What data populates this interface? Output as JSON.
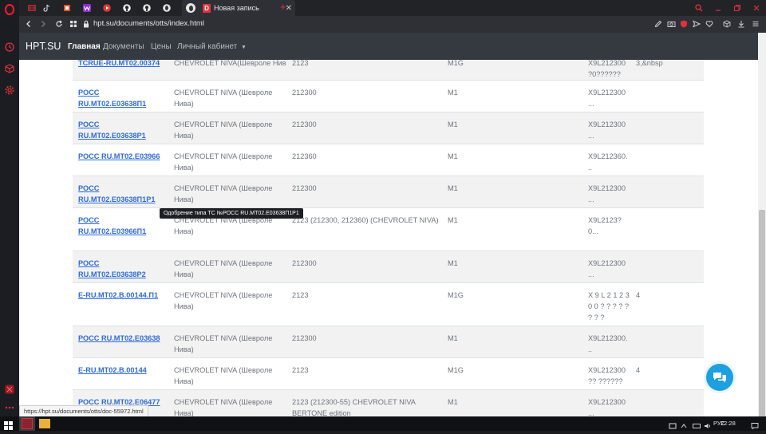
{
  "browser": {
    "tab_title": "Новая запись",
    "tab_letter": "D",
    "url": "hpt.su/documents/otts/index.html",
    "status_url": "https://hpt.su/documents/otts/doc-55972.html",
    "tab_favicons": [
      "opera-gx-icon",
      "tiktok-icon",
      "office-icon",
      "w-icon",
      "youtube-icon",
      "github-icon",
      "github-icon",
      "opera-icon"
    ]
  },
  "navbar": {
    "brand": "HPT.SU",
    "links": [
      {
        "label": "Главная",
        "active": true
      },
      {
        "label": "Документы",
        "active": false
      },
      {
        "label": "Цены",
        "active": false
      },
      {
        "label": "Личный кабинет",
        "active": false
      }
    ]
  },
  "table": {
    "rows": [
      {
        "doc": "TCRUE-RU.MT02.00374",
        "model": "CHEVROLET NIVA(Шевроле Нив",
        "variant": "2123",
        "category": "M1G",
        "vin": "X9L212300 ?0??????",
        "extra": "3,&nbsp"
      },
      {
        "doc": "РОСС RU.MT02.E03638П1",
        "model": "CHEVROLET NIVA (Шевроле Нива)",
        "variant": "212300",
        "category": "M1",
        "vin": "X9L212300 ...",
        "extra": ""
      },
      {
        "doc": "РОСС RU.MT02.E03638P1",
        "model": "CHEVROLET NIVA (Шевроле Нива)",
        "variant": "212300",
        "category": "M1",
        "vin": "X9L212300 ...",
        "extra": ""
      },
      {
        "doc": "РОСС RU.MT02.E03966",
        "model": "CHEVROLET NIVA (Шевроле Нива)",
        "variant": "212360",
        "category": "M1",
        "vin": "X9L212360. ..",
        "extra": ""
      },
      {
        "doc": "РОСС RU.MT02.E03638П1P1",
        "model": "CHEVROLET NIVA (Шевроле Нива)",
        "variant": "212300",
        "category": "M1",
        "vin": "X9L212300 ...",
        "extra": ""
      },
      {
        "doc": "РОСС RU.MT02.E03966П1",
        "model": "CHEVROLET NIVA (Шевроле Нива)",
        "variant": "2123 (212300, 212360) (CHEVROLET NIVA)",
        "category": "M1",
        "vin": "X9L2123? 0...",
        "extra": ""
      },
      {
        "doc": "РОСС RU.MT02.E03638P2",
        "model": "CHEVROLET NIVA (Шевроле Нива)",
        "variant": "212300",
        "category": "M1",
        "vin": "X9L212300 ...",
        "extra": ""
      },
      {
        "doc": "E-RU.MT02.B.00144.П1",
        "model": "CHEVROLET NIVA (Шевроле Нива)",
        "variant": "2123",
        "category": "M1G",
        "vin": "X 9 L 2 1 2 3 0 0 ? ? ? ? ? ? ? ?",
        "extra": "4"
      },
      {
        "doc": "РОСС RU.MT02.E03638",
        "model": "CHEVROLET NIVA (Шевроле Нива)",
        "variant": "212300",
        "category": "M1",
        "vin": "X9L212300. ..",
        "extra": ""
      },
      {
        "doc": "E-RU.MT02.B.00144",
        "model": "CHEVROLET NIVA (Шевроле Нива)",
        "variant": "2123",
        "category": "M1G",
        "vin": "X9L212300 ?? ??????",
        "extra": "4"
      },
      {
        "doc": "РОСС RU.MT02.E06477",
        "model": "CHEVROLET NIVA (Шевроле Нива)",
        "variant": "2123 (212300-55) CHEVROLET NIVA BERTONE edition",
        "category": "M1",
        "vin": "X9L212300 ...",
        "extra": ""
      }
    ]
  },
  "tooltip": "Одобрение типа ТС №РОСС RU.MT02.E03638П1Р1",
  "taskbar": {
    "lang": "РУС",
    "time": "22:28"
  },
  "colors": {
    "navbar_bg": "#343a40",
    "link": "#2d6ae0",
    "chat_button": "#1da0e0",
    "opera_red": "#ff1b2d"
  }
}
